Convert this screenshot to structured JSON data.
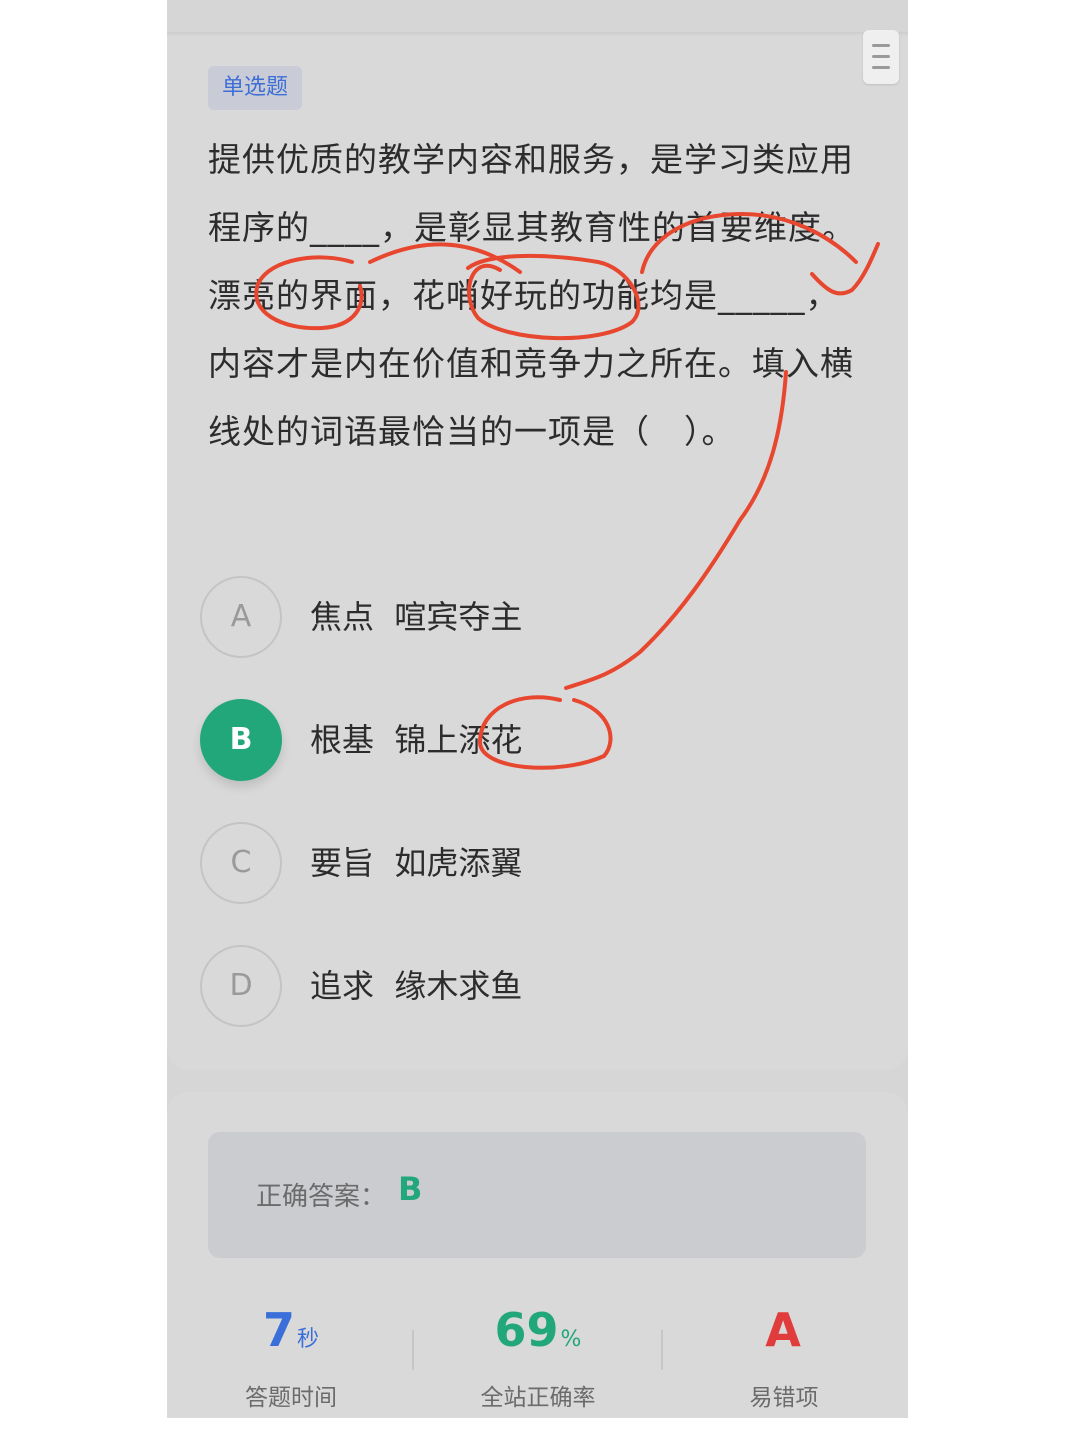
{
  "header": {
    "cut_text": "",
    "menu_icon": "menu-lines-icon"
  },
  "question": {
    "type_tag": "单选题",
    "text": "提供优质的教学内容和服务，是学习类应用程序的____，是彰显其教育性的首要维度。漂亮的界面，花哨好玩的功能均是_____，内容才是内在价值和竞争力之所在。填入横线处的词语最恰当的一项是（　）。"
  },
  "options": [
    {
      "letter": "A",
      "text": "焦点  喧宾夺主",
      "selected": false
    },
    {
      "letter": "B",
      "text": "根基  锦上添花",
      "selected": true
    },
    {
      "letter": "C",
      "text": "要旨  如虎添翼",
      "selected": false
    },
    {
      "letter": "D",
      "text": "追求  缘木求鱼",
      "selected": false
    }
  ],
  "result": {
    "answer_label": "正确答案：",
    "answer_value": "B"
  },
  "stats": [
    {
      "value": "7",
      "unit": "秒",
      "caption": "答题时间",
      "color": "#3a6fd9"
    },
    {
      "value": "69",
      "unit": "%",
      "caption": "全站正确率",
      "color": "#22a77a"
    },
    {
      "value": "A",
      "unit": "",
      "caption": "易错项",
      "color": "#e03c3c"
    }
  ],
  "colors": {
    "accent_green": "#22a77a",
    "tag_blue": "#3d6fd6",
    "annotation_red": "#e8472f"
  }
}
